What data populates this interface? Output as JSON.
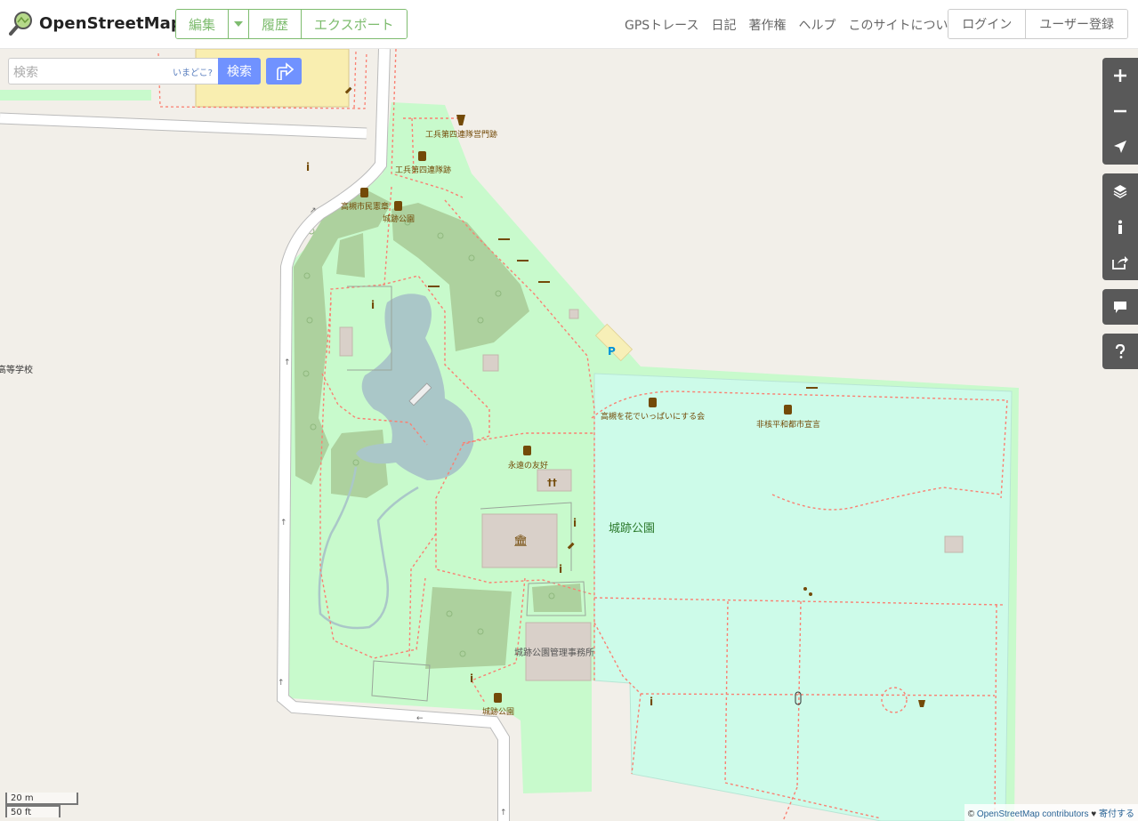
{
  "header": {
    "brand": "OpenStreetMap",
    "edit_group": [
      "編集",
      "履歴",
      "エクスポート"
    ],
    "nav": [
      "GPSトレース",
      "日記",
      "著作権",
      "ヘルプ",
      "このサイトについて"
    ],
    "auth": [
      "ログイン",
      "ユーザー登録"
    ]
  },
  "search": {
    "placeholder": "検索",
    "where_label": "いまどこ?",
    "submit_label": "検索"
  },
  "map_labels": {
    "memorial_gate": "工兵第四連隊営門跡",
    "memorial_regiment": "工兵第四連隊跡",
    "citizen_charter": "高槻市民憲章",
    "park_top": "城跡公園",
    "school": "高等学校",
    "hana": "高槻を花でいっぱいにする会",
    "peace": "非核平和都市宣言",
    "friendship": "永遠の友好",
    "park_main": "城跡公園",
    "office": "城跡公園管理事務所",
    "park_bottom": "城跡公園"
  },
  "map_colors": {
    "park": "#c8facc",
    "pitch": "#cdfbe9",
    "wood": "#add19e",
    "water": "#aad3df",
    "building": "#d9d0c9",
    "road": "#ffffff",
    "path": "#fa8072",
    "background": "#f2efe9"
  },
  "controls": [
    "zoom-in",
    "zoom-out",
    "locate",
    "layers",
    "info",
    "share",
    "note",
    "query"
  ],
  "scale": {
    "metric": "20 m",
    "imperial": "50 ft"
  },
  "attribution": {
    "prefix": "©",
    "link": "OpenStreetMap contributors",
    "heart": "♥",
    "donate": "寄付する"
  }
}
